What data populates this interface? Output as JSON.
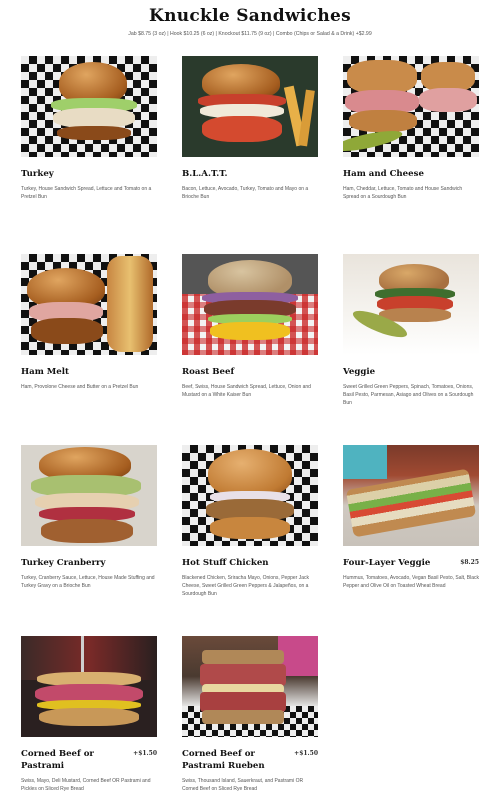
{
  "page": {
    "title": "Knuckle Sandwiches",
    "subtitle": "Jab $8.75 (3 oz) | Hook $10.25 (6 oz) | Knockout $11.75 (9 oz) | Combo (Chips or Salad & a Drink) +$2.99"
  },
  "items": [
    {
      "name": "Turkey",
      "price": "",
      "desc": "Turkey, House Sandwich Spread, Lettuce and Tomato on a Pretzel Bun"
    },
    {
      "name": "B.L.A.T.T.",
      "price": "",
      "desc": "Bacon, Lettuce, Avocado, Turkey, Tomato and Mayo on a Brioche Bun"
    },
    {
      "name": "Ham and Cheese",
      "price": "",
      "desc": "Ham, Cheddar, Lettuce, Tomato and House Sandwich Spread on a Sourdough Bun"
    },
    {
      "name": "Ham Melt",
      "price": "",
      "desc": "Ham, Provolone Cheese and Butter on a Pretzel Bun"
    },
    {
      "name": "Roast Beef",
      "price": "",
      "desc": "Beef, Swiss, House Sandwich Spread, Lettuce, Onion and Mustard on a White Kaiser Bun"
    },
    {
      "name": "Veggie",
      "price": "",
      "desc": "Sweet Grilled Green Peppers, Spinach, Tomatoes, Onions, Basil Pesto, Parmesan, Asiago and Olives on a Sourdough Bun"
    },
    {
      "name": "Turkey Cranberry",
      "price": "",
      "desc": "Turkey, Cranberry Sauce, Lettuce, House Made Stuffing and Turkey Gravy on a Brioche Bun"
    },
    {
      "name": "Hot Stuff Chicken",
      "price": "",
      "desc": "Blackened Chicken, Sriracha Mayo, Onions, Pepper Jack Cheese, Sweet Grilled Green Peppers & Jalapeños, on a Sourdough Bun"
    },
    {
      "name": "Four-Layer Veggie",
      "price": "$8.25",
      "desc": "Hummus, Tomatoes, Avocado, Vegan Basil Pesto, Salt, Black Pepper and Olive Oil on Toasted Wheat Bread"
    },
    {
      "name": "Corned Beef or Pastrami",
      "price": "+$1.50",
      "desc": "Swiss, Mayo, Deli Mustard, Corned Beef OR Pastrami and Pickles on Sliced Rye Bread"
    },
    {
      "name": "Corned Beef or Pastrami Rueben",
      "price": "+$1.50",
      "desc": "Swiss, Thousand Island, Sauerkraut, and Pastrami OR Corned Beef on Sliced Rye Bread"
    }
  ]
}
